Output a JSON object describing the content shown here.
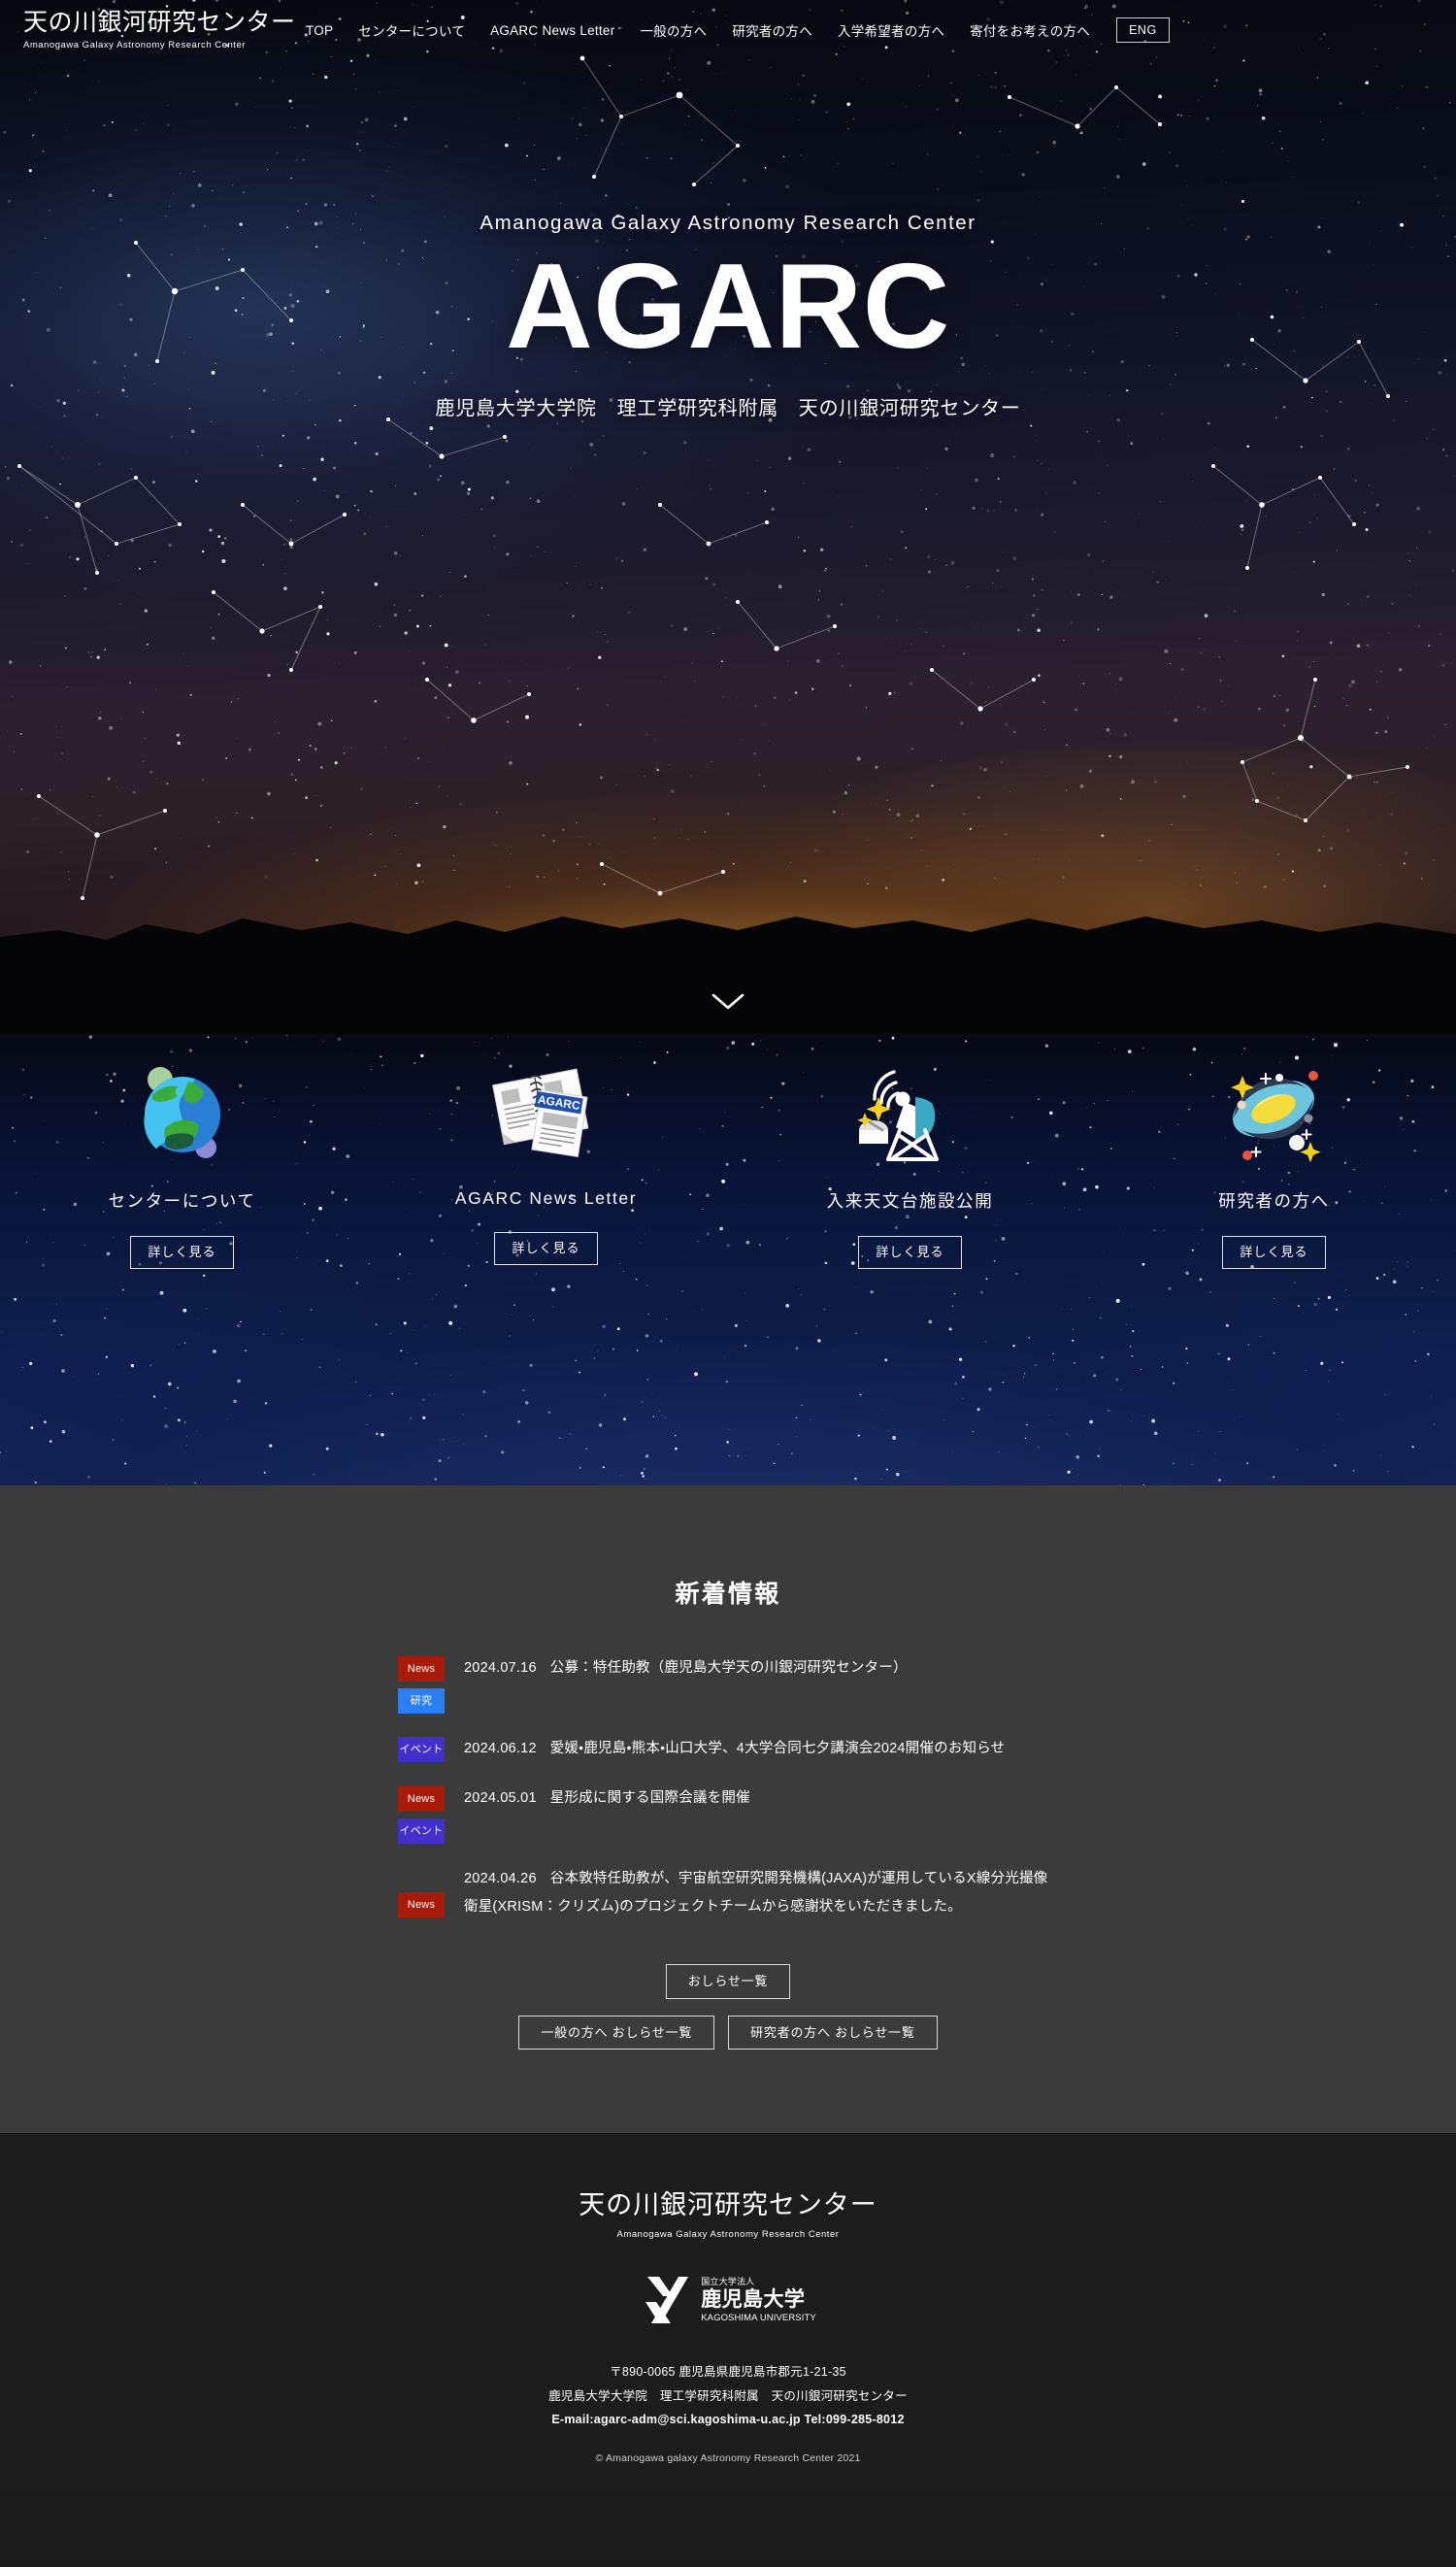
{
  "header": {
    "brand_jp": "天の川銀河研究センター",
    "brand_en": "Amanogawa Galaxy Astronomy Research Center",
    "nav": [
      {
        "label": "TOP"
      },
      {
        "label": "センターについて"
      },
      {
        "label": "AGARC News Letter"
      },
      {
        "label": "一般の方へ"
      },
      {
        "label": "研究者の方へ"
      },
      {
        "label": "入学希望者の方へ"
      },
      {
        "label": "寄付をお考えの方へ"
      }
    ],
    "lang_button": "ENG"
  },
  "hero": {
    "subtitle_en": "Amanogawa Galaxy Astronomy Research Center",
    "title": "AGARC",
    "subtitle_jp": "鹿児島大学大学院　理工学研究科附属　天の川銀河研究センター",
    "scroll_icon": "chevron-down-icon"
  },
  "features": [
    {
      "icon": "earth-icon",
      "label": "センターについて",
      "button": "詳しく見る"
    },
    {
      "icon": "newsletter-icon",
      "label": "AGARC News Letter",
      "button": "詳しく見る"
    },
    {
      "icon": "telescope-icon",
      "label": "入来天文台施設公開",
      "button": "詳しく見る"
    },
    {
      "icon": "galaxy-icon",
      "label": "研究者の方へ",
      "button": "詳しく見る"
    }
  ],
  "news": {
    "title": "新着情報",
    "items": [
      {
        "badges": [
          {
            "text": "News",
            "type": "news"
          },
          {
            "text": "研究",
            "type": "study"
          }
        ],
        "date": "2024.07.16",
        "text": "公募：特任助教（鹿児島大学天の川銀河研究センター）"
      },
      {
        "badges": [
          {
            "text": "イベント",
            "type": "event"
          }
        ],
        "date": "2024.06.12",
        "text": "愛媛・鹿児島・熊本・山口大学、4大学合同七夕講演会2024開催のお知らせ"
      },
      {
        "badges": [
          {
            "text": "News",
            "type": "news"
          },
          {
            "text": "イベント",
            "type": "event"
          }
        ],
        "date": "2024.05.01",
        "text": "星形成に関する国際会議を開催"
      },
      {
        "badges": [
          {
            "text": "News",
            "type": "news"
          }
        ],
        "date": "2024.04.26",
        "text": "谷本敦特任助教が、宇宙航空研究開発機構(JAXA)が運用しているX線分光撮像衛星(XRISM：クリズム)のプロジェクトチームから感謝状をいただきました。"
      }
    ],
    "buttons": {
      "all": "おしらせ一覧",
      "general": "一般の方へ おしらせ一覧",
      "researcher": "研究者の方へ おしらせ一覧"
    }
  },
  "footer": {
    "name_jp": "天の川銀河研究センター",
    "name_en": "Amanogawa Galaxy Astronomy Research Center",
    "university": {
      "top": "国立大学法人",
      "main": "鹿児島大学",
      "en": "KAGOSHIMA UNIVERSITY",
      "mark": "kagoshima-k-mark-icon"
    },
    "address_line1": "〒890-0065 鹿児島県鹿児島市郡元1-21-35",
    "address_line2": "鹿児島大学大学院　理工学研究科附属　天の川銀河研究センター",
    "contact": "E-mail:agarc-adm@sci.kagoshima-u.ac.jp Tel:099-285-8012",
    "copyright": "© Amanogawa galaxy Astronomy Research Center 2021"
  },
  "colors": {
    "badge_news": "#a81b09",
    "badge_study": "#2b7ff5",
    "badge_event": "#4330cb",
    "news_bg": "#3b3b3b",
    "footer_bg": "#1c1c1c"
  }
}
